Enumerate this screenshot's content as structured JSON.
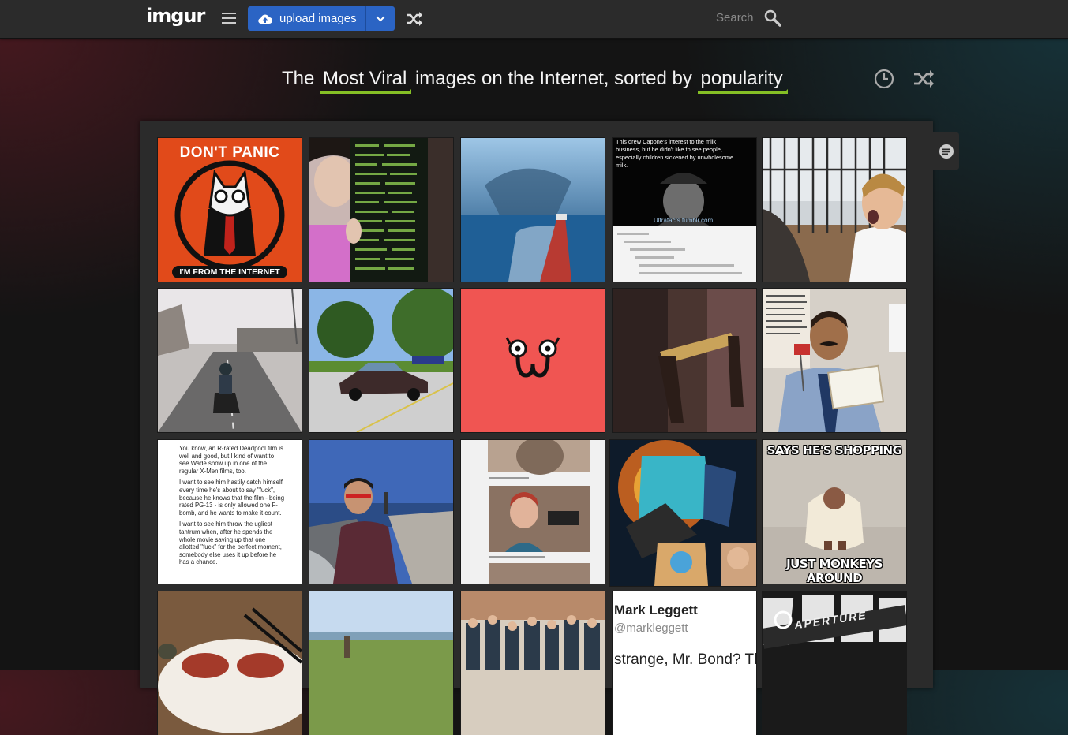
{
  "header": {
    "logo": "imgur",
    "upload_label": "upload images",
    "search_label": "Search",
    "icons": [
      "menu-icon",
      "cloud-upload-icon",
      "chevron-down-icon",
      "shuffle-icon",
      "search-icon"
    ]
  },
  "headline": {
    "prefix": "The",
    "section": "Most Viral",
    "middle": "images on the Internet, sorted by",
    "sort": "popularity",
    "icons": [
      "clock-icon",
      "shuffle-icon"
    ]
  },
  "colors": {
    "accent_green": "#85bf25",
    "upload_blue": "#2b64c4",
    "panel": "#2b2b2b"
  },
  "gallery": {
    "t1": {
      "top": "DON'T PANIC",
      "bottom": "I'M FROM THE INTERNET"
    },
    "t4": {
      "lines": [
        "This drew Capone's interest to the milk",
        "business, but he didn't like to see people,",
        "especially children sickened by unwholesome",
        "milk."
      ],
      "credit": "Ultrafacts.tumblr.com"
    },
    "t11": {
      "lines": [
        "You know, an R-rated Deadpool film is",
        "well and good, but I kind of want to",
        "see Wade show up in one of the",
        "regular X-Men films, too.",
        "",
        "I want to see him hastily catch himself",
        "every time he's about to say \"fuck\",",
        "because he knows that the film - being",
        "rated PG-13 - is only allowed one F-",
        "bomb, and he wants to make it count.",
        "",
        "I want to see him throw the ugliest",
        "tantrum when, after he spends the",
        "whole movie saving up that one",
        "allotted \"fuck\" for the perfect moment,",
        "somebody else uses it up before he",
        "has a chance."
      ]
    },
    "t15": {
      "top": "SAYS HE'S SHOPPING",
      "bottom": "JUST MONKEYS AROUND"
    },
    "t19": {
      "name": "Mark Leggett",
      "handle": "@markleggett",
      "snippet": "strange, Mr. Bond? Th"
    },
    "t20": {
      "sign": "APERTURE"
    }
  }
}
